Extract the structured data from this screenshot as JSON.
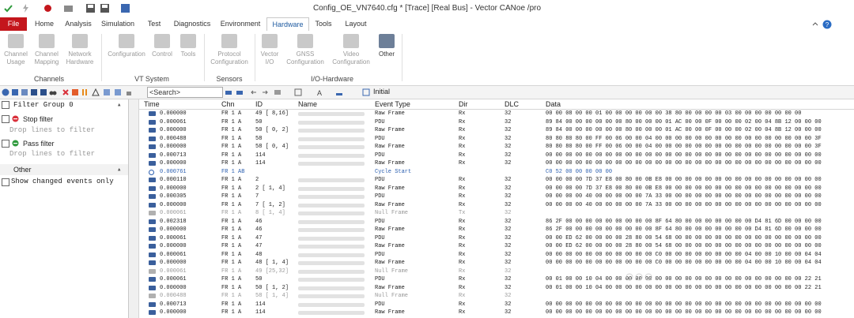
{
  "window": {
    "title": "Config_OE_VN7640.cfg * [Trace] [Real Bus] - Vector CANoe /pro"
  },
  "tabs": [
    {
      "label": "File"
    },
    {
      "label": "Home"
    },
    {
      "label": "Analysis"
    },
    {
      "label": "Simulation"
    },
    {
      "label": "Test"
    },
    {
      "label": "Diagnostics"
    },
    {
      "label": "Environment"
    },
    {
      "label": "Hardware"
    },
    {
      "label": "Tools"
    },
    {
      "label": "Layout"
    }
  ],
  "ribbon": {
    "buttons": [
      {
        "label": "Channel\nUsage"
      },
      {
        "label": "Channel\nMapping"
      },
      {
        "label": "Network\nHardware"
      },
      {
        "label": "Configuration"
      },
      {
        "label": "Control"
      },
      {
        "label": "Tools"
      },
      {
        "label": "Protocol\nConfiguration"
      },
      {
        "label": "Vector\nI/O"
      },
      {
        "label": "GNSS\nConfiguration"
      },
      {
        "label": "Video\nConfiguration"
      },
      {
        "label": "Other"
      }
    ],
    "groups": [
      {
        "label": "Channels"
      },
      {
        "label": "VT System"
      },
      {
        "label": "Sensors"
      },
      {
        "label": "I/O-Hardware"
      }
    ]
  },
  "toolbar": {
    "search_placeholder": "<Search>",
    "initial_label": "Initial"
  },
  "filters": {
    "group_label": "Filter Group 0",
    "stop_label": "Stop filter",
    "stop_hint": "Drop lines to filter",
    "pass_label": "Pass filter",
    "pass_hint": "Drop lines to filter",
    "other_label": "Other",
    "show_changed_label": "Show changed events only"
  },
  "trace": {
    "columns": [
      "Time",
      "Chn",
      "ID",
      "Name",
      "Event Type",
      "Dir",
      "DLC",
      "Data"
    ],
    "rows": [
      {
        "time": "0.000000",
        "chn": "FR 1 A",
        "id": "49 [ 8,16]",
        "event": "Raw Frame",
        "dir": "Rx",
        "dlc": "32",
        "data": "00 00 08 00 00 01 00 00 00 00 00 00 38 80 00 00 00 00 03 00 00 00 00 00 00 00",
        "style": ""
      },
      {
        "time": "0.000061",
        "chn": "FR 1 A",
        "id": "50",
        "event": "PDU",
        "dir": "Rx",
        "dlc": "32",
        "data": "89 84 00 00 00 00 00 00 80 00 00 00 01 AC 00 00 0F 00 00 00 02 00 04 8B 12 00 00 00",
        "style": ""
      },
      {
        "time": "0.000000",
        "chn": "FR 1 A",
        "id": "50 [ 0, 2]",
        "event": "Raw Frame",
        "dir": "Rx",
        "dlc": "32",
        "data": "89 84 00 00 00 00 00 00 80 00 00 00 01 AC 00 00 0F 00 00 00 02 00 04 8B 12 00 00 00",
        "style": ""
      },
      {
        "time": "0.000488",
        "chn": "FR 1 A",
        "id": "58",
        "event": "PDU",
        "dir": "Rx",
        "dlc": "32",
        "data": "80 80 80 80 00 FF 00 06 00 00 04 00 00 00 00 00 00 00 00 00 00 00 00 00 00 00 00 3F",
        "style": ""
      },
      {
        "time": "0.000000",
        "chn": "FR 1 A",
        "id": "58 [ 0, 4]",
        "event": "Raw Frame",
        "dir": "Rx",
        "dlc": "32",
        "data": "80 80 80 80 00 FF 00 06 00 00 04 00 00 00 00 00 00 00 00 00 00 00 00 00 00 00 00 3F",
        "style": ""
      },
      {
        "time": "0.000713",
        "chn": "FR 1 A",
        "id": "114",
        "event": "PDU",
        "dir": "Rx",
        "dlc": "32",
        "data": "00 00 00 00 00 00 00 00 00 00 00 00 00 00 00 00 00 00 00 00 00 00 00 00 00 00 00 00",
        "style": ""
      },
      {
        "time": "0.000000",
        "chn": "FR 1 A",
        "id": "114",
        "event": "Raw Frame",
        "dir": "Rx",
        "dlc": "32",
        "data": "00 00 00 00 00 00 00 00 00 00 00 00 00 00 00 00 00 00 00 00 00 00 00 00 00 00 00 00",
        "style": ""
      },
      {
        "time": "0.000761",
        "chn": "FR 1 AB",
        "id": "",
        "event": "Cycle Start",
        "dir": "",
        "dlc": "",
        "data": "C0 52 00 00 00 00 00",
        "style": "blue"
      },
      {
        "time": "0.000110",
        "chn": "FR 1 A",
        "id": "2",
        "event": "PDU",
        "dir": "Rx",
        "dlc": "32",
        "data": "00 00 00 00 7D 37 E8 00 80 00 0B E8 00 00 00 00 00 00 00 00 00 00 00 00 00 00 00 00",
        "style": ""
      },
      {
        "time": "0.000000",
        "chn": "FR 1 A",
        "id": "2 [ 1, 4]",
        "event": "Raw Frame",
        "dir": "Rx",
        "dlc": "32",
        "data": "00 00 00 00 7D 37 E8 00 80 00 0B E8 00 00 00 00 00 00 00 00 00 00 00 00 00 00 00 00",
        "style": ""
      },
      {
        "time": "0.000305",
        "chn": "FR 1 A",
        "id": "7",
        "event": "PDU",
        "dir": "Rx",
        "dlc": "32",
        "data": "00 00 00 00 40 00 00 00 00 00 7A 33 00 00 00 00 00 00 00 00 00 00 00 00 00 00 00 00",
        "style": ""
      },
      {
        "time": "0.000000",
        "chn": "FR 1 A",
        "id": "7 [ 1, 2]",
        "event": "Raw Frame",
        "dir": "Rx",
        "dlc": "32",
        "data": "00 00 00 00 40 00 00 00 00 00 7A 33 00 00 00 00 00 00 00 00 00 00 00 00 00 00 00 00",
        "style": ""
      },
      {
        "time": "0.000061",
        "chn": "FR 1 A",
        "id": "8 [ 1, 4]",
        "event": "Null Frame",
        "dir": "Tx",
        "dlc": "32",
        "data": "",
        "style": "grey"
      },
      {
        "time": "0.002318",
        "chn": "FR 1 A",
        "id": "46",
        "event": "PDU",
        "dir": "Rx",
        "dlc": "32",
        "data": "86 2F 00 00 00 00 00 00 00 00 00 8F 64 80 00 00 00 00 00 00 00 D4 81 6D 00 00 00 00",
        "style": ""
      },
      {
        "time": "0.000000",
        "chn": "FR 1 A",
        "id": "46",
        "event": "Raw Frame",
        "dir": "Rx",
        "dlc": "32",
        "data": "86 2F 00 00 00 00 00 00 00 00 00 8F 64 80 00 00 00 00 00 00 00 D4 81 6D 00 00 00 00",
        "style": ""
      },
      {
        "time": "0.000061",
        "chn": "FR 1 A",
        "id": "47",
        "event": "PDU",
        "dir": "Rx",
        "dlc": "32",
        "data": "00 00 ED 62 00 00 00 00 28 80 00 54 68 00 00 00 00 00 00 00 00 00 00 00 00 00 00 00",
        "style": ""
      },
      {
        "time": "0.000000",
        "chn": "FR 1 A",
        "id": "47",
        "event": "Raw Frame",
        "dir": "Rx",
        "dlc": "32",
        "data": "00 00 ED 62 00 00 00 00 28 80 00 54 68 00 00 00 00 00 00 00 00 00 00 00 00 00 00 00",
        "style": ""
      },
      {
        "time": "0.000061",
        "chn": "FR 1 A",
        "id": "48",
        "event": "PDU",
        "dir": "Rx",
        "dlc": "32",
        "data": "00 00 00 00 00 00 00 00 00 00 00 C0 00 00 00 00 00 00 00 00 04 00 00 10 00 00 04 04",
        "style": ""
      },
      {
        "time": "0.000000",
        "chn": "FR 1 A",
        "id": "48 [ 1, 4]",
        "event": "Raw Frame",
        "dir": "Rx",
        "dlc": "32",
        "data": "00 00 00 00 00 00 00 00 00 00 00 C0 00 00 00 00 00 00 00 00 04 00 00 10 00 00 04 04",
        "style": ""
      },
      {
        "time": "0.000061",
        "chn": "FR 1 A",
        "id": "49 [25,32]",
        "event": "Null Frame",
        "dir": "Rx",
        "dlc": "32",
        "data": "",
        "style": "grey"
      },
      {
        "time": "0.000061",
        "chn": "FR 1 A",
        "id": "50",
        "event": "PDU",
        "dir": "Rx",
        "dlc": "32",
        "data": "00 01 00 00 10 04 00 00 00 00 00 00 00 00 00 00 00 00 00 00 00 00 00 00 00 00 22 21",
        "style": ""
      },
      {
        "time": "0.000000",
        "chn": "FR 1 A",
        "id": "50 [ 1, 2]",
        "event": "Raw Frame",
        "dir": "Rx",
        "dlc": "32",
        "data": "00 01 00 00 10 04 00 00 00 00 00 00 00 00 00 00 00 00 00 00 00 00 00 00 00 00 22 21",
        "style": ""
      },
      {
        "time": "0.000488",
        "chn": "FR 1 A",
        "id": "58 [ 1, 4]",
        "event": "Null Frame",
        "dir": "Rx",
        "dlc": "32",
        "data": "",
        "style": "grey"
      },
      {
        "time": "0.000713",
        "chn": "FR 1 A",
        "id": "114",
        "event": "PDU",
        "dir": "Rx",
        "dlc": "32",
        "data": "00 00 00 00 00 00 00 00 00 00 00 00 00 00 00 00 00 00 00 00 00 00 00 00 00 00 00 00",
        "style": ""
      },
      {
        "time": "0.000000",
        "chn": "FR 1 A",
        "id": "114",
        "event": "Raw Frame",
        "dir": "Rx",
        "dlc": "32",
        "data": "00 00 00 00 00 00 00 00 00 00 00 00 00 00 00 00 00 00 00 00 00 00 00 00 00 00 00 00",
        "style": ""
      }
    ]
  },
  "colors": {
    "file_tab": "#c4161c",
    "active_tab_text": "#1e5aa0",
    "stop_icon": "#d9303a",
    "pass_icon": "#2e9a3c"
  },
  "icons": [
    "checkmark-icon",
    "undo-icon",
    "record-icon",
    "save-icon",
    "help-icon",
    "channel-usage-icon",
    "channel-mapping-icon",
    "network-hardware-icon",
    "stop-icon",
    "pass-icon"
  ]
}
